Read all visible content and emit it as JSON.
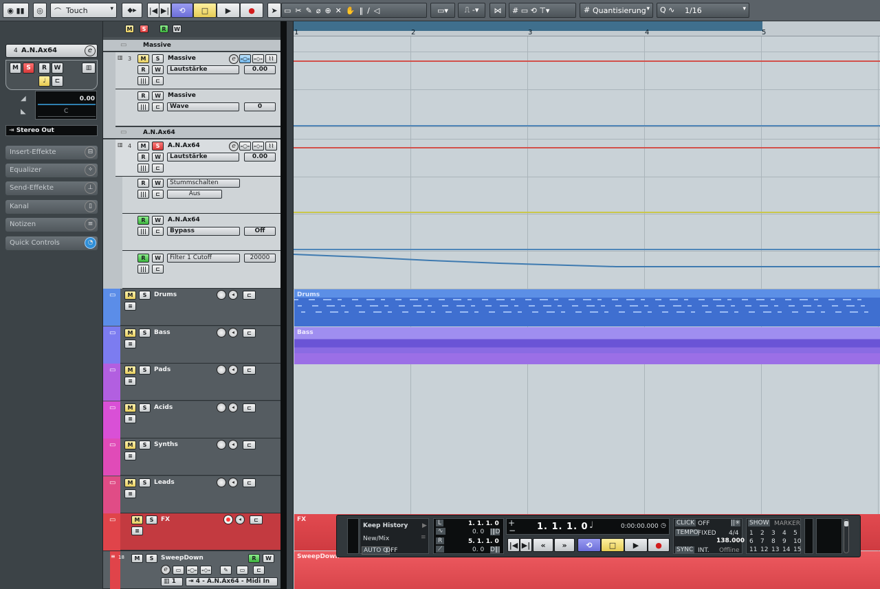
{
  "toolbar": {
    "automation_mode": "Touch",
    "quantize_label": "Quantisierung",
    "quantize_value": "1/16"
  },
  "inspector": {
    "track_number": "4",
    "track_name": "A.N.Ax64",
    "buttons": {
      "mute": "M",
      "solo": "S",
      "read": "R",
      "write": "W"
    },
    "volume_value": "0.00",
    "pan_value": "C",
    "output": "Stereo Out",
    "sections": [
      {
        "label": "Insert-Effekte",
        "icon": "insert-icon"
      },
      {
        "label": "Equalizer",
        "icon": "eq-icon"
      },
      {
        "label": "Send-Effekte",
        "icon": "send-icon"
      },
      {
        "label": "Kanal",
        "icon": "channel-icon"
      },
      {
        "label": "Notizen",
        "icon": "notes-icon"
      },
      {
        "label": "Quick Controls",
        "icon": "quick-controls-icon"
      }
    ]
  },
  "header_toggles": {
    "m": "M",
    "s": "S",
    "r": "R",
    "w": "W"
  },
  "tracks": {
    "massive_folder": "Massive",
    "massive_track": {
      "number": "3",
      "name": "Massive",
      "param": "Lautstärke",
      "value": "0.00"
    },
    "massive_lane": {
      "name": "Massive",
      "param": "Wave",
      "value": "0"
    },
    "anax_folder": "A.N.Ax64",
    "anax_track": {
      "number": "4",
      "name": "A.N.Ax64",
      "param": "Lautstärke",
      "value": "0.00"
    },
    "anax_mute_lane": {
      "param": "Stummschalten",
      "value": "Aus"
    },
    "anax_bypass_lane": {
      "name": "A.N.Ax64",
      "param": "Bypass",
      "value": "Off"
    },
    "anax_filter_lane": {
      "param": "Filter 1 Cutoff",
      "value": "20000"
    },
    "folders": [
      {
        "name": "Drums",
        "color": "#5b8de8"
      },
      {
        "name": "Bass",
        "color": "#7c7cf0"
      },
      {
        "name": "Pads",
        "color": "#b25fe0"
      },
      {
        "name": "Acids",
        "color": "#d950d6"
      },
      {
        "name": "Synths",
        "color": "#e04bb8"
      },
      {
        "name": "Leads",
        "color": "#e04c86"
      },
      {
        "name": "FX",
        "color": "#e0444a"
      }
    ],
    "sweep": {
      "number": "18",
      "name": "SweepDown",
      "input": "1",
      "output": "4 - A.N.Ax64 - Midi In"
    }
  },
  "ruler": {
    "bars": [
      "1",
      "2",
      "3",
      "4",
      "5"
    ]
  },
  "parts": {
    "drums": "Drums",
    "bass": "Bass",
    "fx": "FX",
    "sweep": "SweepDown"
  },
  "transport": {
    "keep_history": "Keep History",
    "new_mix": "New/Mix",
    "auto_q": "AUTO Q",
    "auto_q_state": "OFF",
    "left_locator": "1. 1. 1. 0",
    "punch_in": "0. 0",
    "right_locator": "5. 1. 1. 0",
    "punch_out": "0. 0",
    "position_bars": "1. 1. 1. 0",
    "position_time": "0:00:00.000",
    "click": "CLICK",
    "click_state": "OFF",
    "tempo": "TEMPO",
    "tempo_mode": "FIXED",
    "signature": "4/4",
    "tempo_value": "138.000",
    "sync": "SYNC",
    "sync_mode": "INT.",
    "sync_state": "Offline",
    "show": "SHOW",
    "marker": "MARKER",
    "marker_numbers": [
      "1",
      "2",
      "3",
      "4",
      "5",
      "6",
      "7",
      "8",
      "9",
      "10",
      "11",
      "12",
      "13",
      "14",
      "15"
    ]
  }
}
